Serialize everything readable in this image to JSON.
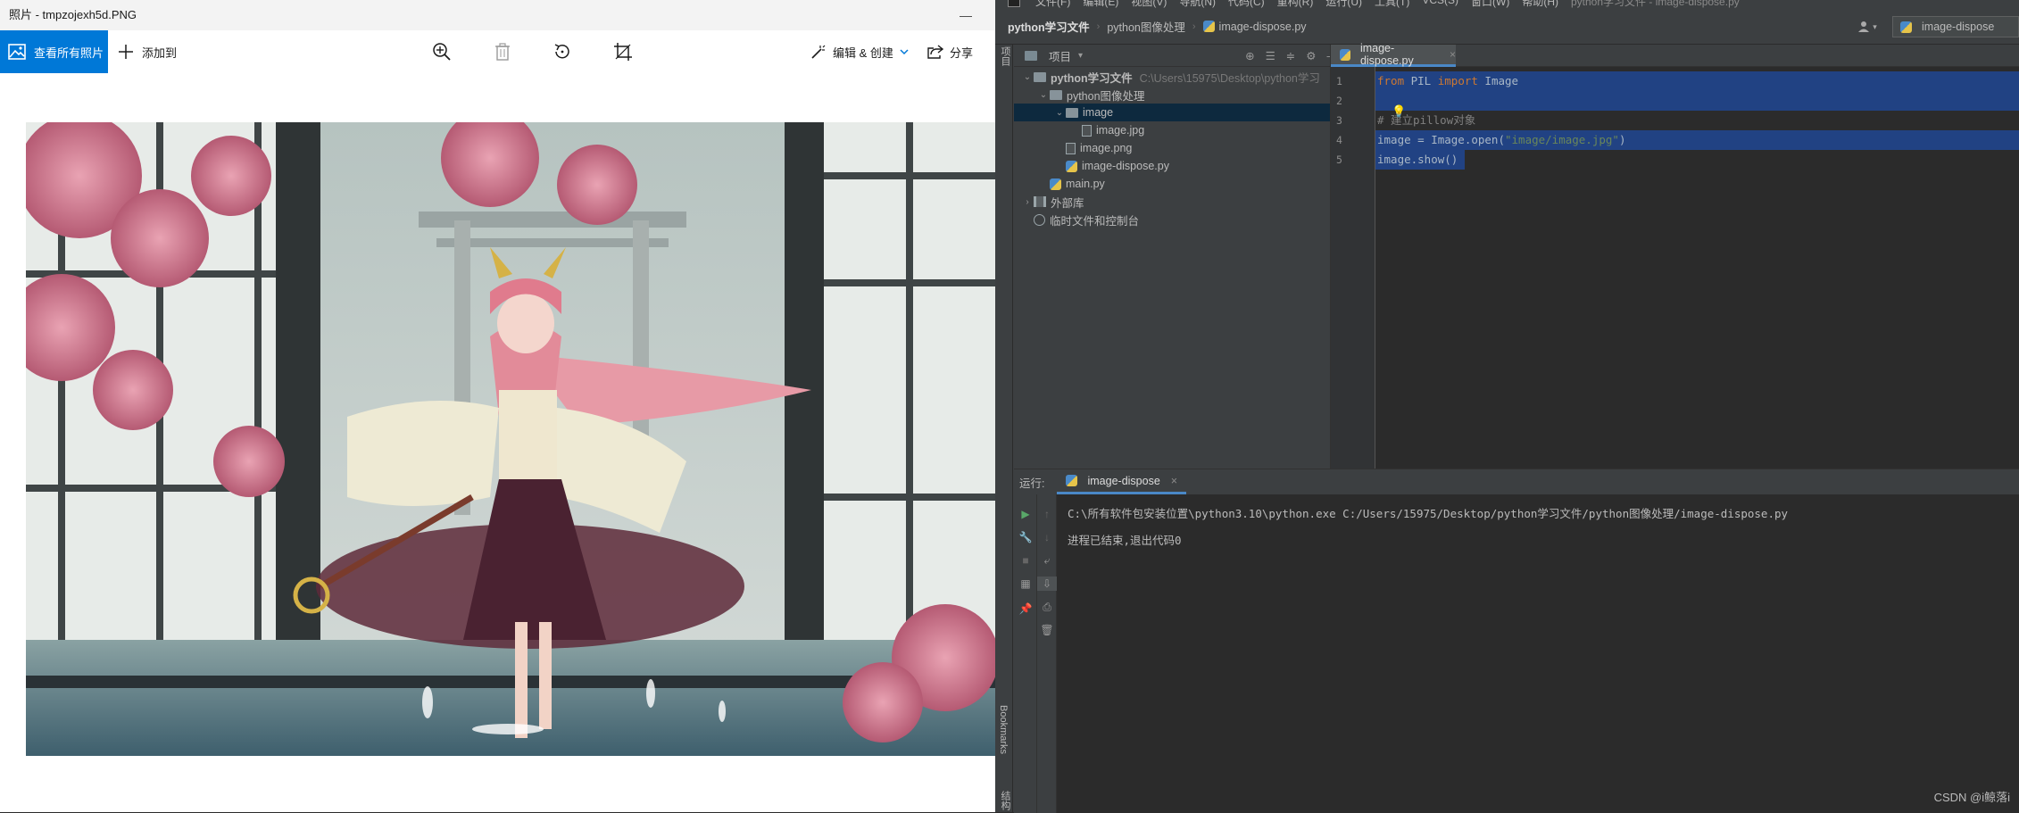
{
  "photos": {
    "window_title": "照片 - tmpzojexh5d.PNG",
    "minimize_label": "—",
    "toolbar": {
      "see_all_label": "查看所有照片",
      "add_to_label": "添加到",
      "edit_create_label": "编辑 & 创建",
      "share_label": "分享"
    }
  },
  "ide": {
    "menu_items": [
      "文件(F)",
      "编辑(E)",
      "视图(V)",
      "导航(N)",
      "代码(C)",
      "重构(R)",
      "运行(U)",
      "工具(T)",
      "VCS(S)",
      "窗口(W)",
      "帮助(H)"
    ],
    "window_title": "python学习文件 - image-dispose.py",
    "breadcrumbs": [
      "python学习文件",
      "python图像处理",
      "image-dispose.py"
    ],
    "run_config": "image-dispose",
    "left_strip": {
      "project_tab": "项目",
      "bookmarks_tab": "Bookmarks",
      "structure_tab": "结构"
    },
    "project_panel": {
      "title": "项目",
      "tree": [
        {
          "label": "python学习文件",
          "path": "C:\\Users\\15975\\Desktop\\python学习",
          "type": "folder",
          "expanded": true,
          "depth": 0
        },
        {
          "label": "python图像处理",
          "type": "folder",
          "expanded": true,
          "depth": 1
        },
        {
          "label": "image",
          "type": "folder",
          "expanded": true,
          "depth": 2,
          "selected": true
        },
        {
          "label": "image.jpg",
          "type": "file",
          "depth": 3
        },
        {
          "label": "image.png",
          "type": "file",
          "depth": 2
        },
        {
          "label": "image-dispose.py",
          "type": "py",
          "depth": 2
        },
        {
          "label": "main.py",
          "type": "py",
          "depth": 1
        },
        {
          "label": "外部库",
          "type": "lib",
          "expanded": false,
          "depth": 0
        },
        {
          "label": "临时文件和控制台",
          "type": "scratch",
          "depth": 0
        }
      ]
    },
    "editor": {
      "tab_label": "image-dispose.py",
      "lines": [
        {
          "num": "1",
          "code": [
            {
              "t": "from",
              "c": "kw"
            },
            {
              "t": " PIL ",
              "c": "id"
            },
            {
              "t": "import",
              "c": "kw"
            },
            {
              "t": " Image",
              "c": "id"
            }
          ]
        },
        {
          "num": "2",
          "code": []
        },
        {
          "num": "3",
          "code": [
            {
              "t": "# 建立pillow对象",
              "c": "cm"
            }
          ]
        },
        {
          "num": "4",
          "code": [
            {
              "t": "image = Image.open(",
              "c": "id"
            },
            {
              "t": "\"image/image.jpg\"",
              "c": "st"
            },
            {
              "t": ")",
              "c": "id"
            }
          ]
        },
        {
          "num": "5",
          "code": [
            {
              "t": "image.show()",
              "c": "id"
            }
          ]
        }
      ]
    },
    "run_panel": {
      "label": "运行:",
      "tab_label": "image-dispose",
      "console": [
        "C:\\所有软件包安装位置\\python3.10\\python.exe C:/Users/15975/Desktop/python学习文件/python图像处理/image-dispose.py",
        "",
        "进程已结束,退出代码0"
      ]
    },
    "watermark": "CSDN @i鲸落i"
  },
  "colors": {
    "accent_blue": "#0078d7",
    "ide_bg": "#2b2b2b",
    "ide_panel": "#3c3f41",
    "selection": "#214283",
    "keyword": "#cc7832",
    "string": "#6a8759",
    "comment": "#808080"
  }
}
